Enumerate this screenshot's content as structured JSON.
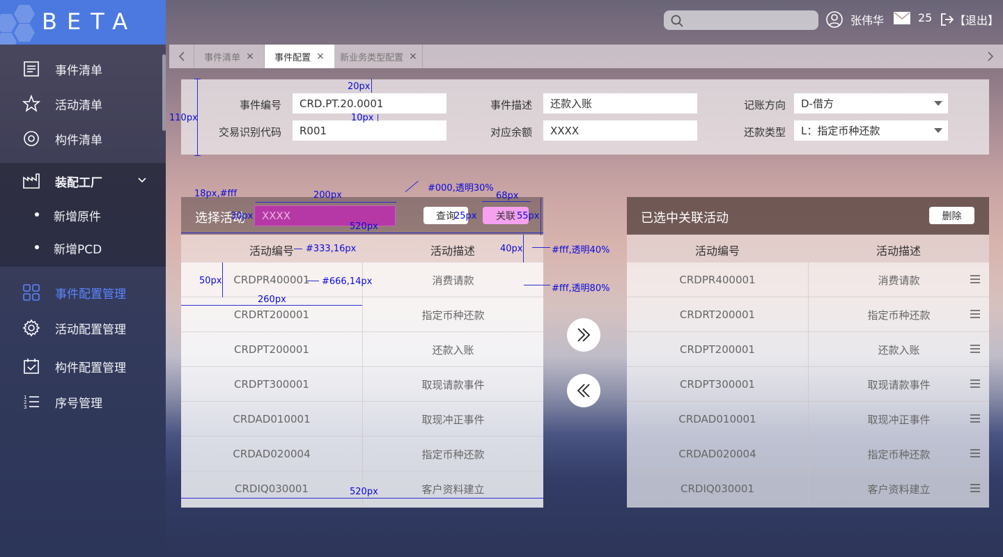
{
  "app": {
    "logo": "BETA"
  },
  "sidebar": {
    "items": [
      {
        "label": "事件清单",
        "icon": "list-icon"
      },
      {
        "label": "活动清单",
        "icon": "star-icon"
      },
      {
        "label": "构件清单",
        "icon": "target-icon"
      }
    ],
    "group": {
      "label": "装配工厂",
      "icon": "factory-icon",
      "expanded": true,
      "subitems": [
        {
          "label": "新增原件"
        },
        {
          "label": "新增PCD"
        }
      ]
    },
    "items2": [
      {
        "label": "事件配置管理",
        "icon": "grid-icon",
        "active": true
      },
      {
        "label": "活动配置管理",
        "icon": "gear-icon"
      },
      {
        "label": "构件配置管理",
        "icon": "calendar-check-icon"
      },
      {
        "label": "序号管理",
        "icon": "numbered-list-icon"
      }
    ]
  },
  "header": {
    "search_placeholder": "",
    "user_name": "张伟华",
    "mail_count": "25",
    "logout": "【退出】"
  },
  "tabs": [
    {
      "label": "事件清单"
    },
    {
      "label": "事件配置",
      "active": true
    },
    {
      "label": "新业务类型配置"
    }
  ],
  "form": {
    "event_no_label": "事件编号",
    "event_no_value": "CRD.PT.20.0001",
    "txn_code_label": "交易识别代码",
    "txn_code_value": "R001",
    "event_desc_label": "事件描述",
    "event_desc_value": "还款入账",
    "balance_label": "对应余额",
    "balance_value": "XXXX",
    "direction_label": "记账方向",
    "direction_value": "D-借方",
    "repay_type_label": "还款类型",
    "repay_type_value": "L：指定币种还款"
  },
  "left_panel": {
    "title": "选择活动",
    "search_value": "XXXX",
    "query_button": "查询",
    "link_button": "关联",
    "columns": [
      "活动编号",
      "活动描述"
    ],
    "rows": [
      [
        "CRDPR400001",
        "消费请款"
      ],
      [
        "CRDRT200001",
        "指定币种还款"
      ],
      [
        "CRDPT200001",
        "还款入账"
      ],
      [
        "CRDPT300001",
        "取现请款事件"
      ],
      [
        "CRDAD010001",
        "取现冲正事件"
      ],
      [
        "CRDAD020004",
        "指定币种还款"
      ],
      [
        "CRDIQ030001",
        "客户资料建立"
      ]
    ]
  },
  "right_panel": {
    "title": "已选中关联活动",
    "delete_button": "删除",
    "columns": [
      "活动编号",
      "活动描述"
    ],
    "rows": [
      [
        "CRDPR400001",
        "消费请款"
      ],
      [
        "CRDRT200001",
        "指定币种还款"
      ],
      [
        "CRDPT200001",
        "还款入账"
      ],
      [
        "CRDPT300001",
        "取现请款事件"
      ],
      [
        "CRDAD010001",
        "取现冲正事件"
      ],
      [
        "CRDAD020004",
        "指定币种还款"
      ],
      [
        "CRDIQ030001",
        "客户资料建立"
      ]
    ]
  },
  "annotations": {
    "a20": "20px",
    "a110": "110px",
    "a10": "10px",
    "a18": "18px,#fff",
    "a200": "200px",
    "a000": "#000,透明30%",
    "a68": "68px",
    "a25": "25px",
    "a55": "55px",
    "a30": "30px",
    "a520a": "520px",
    "a333": "#333,16px",
    "a40": "40px",
    "afff40": "#fff,透明40%",
    "a50": "50px",
    "a666": "#666,14px",
    "afff80": "#fff,透明80%",
    "a260": "260px",
    "a520b": "520px"
  }
}
